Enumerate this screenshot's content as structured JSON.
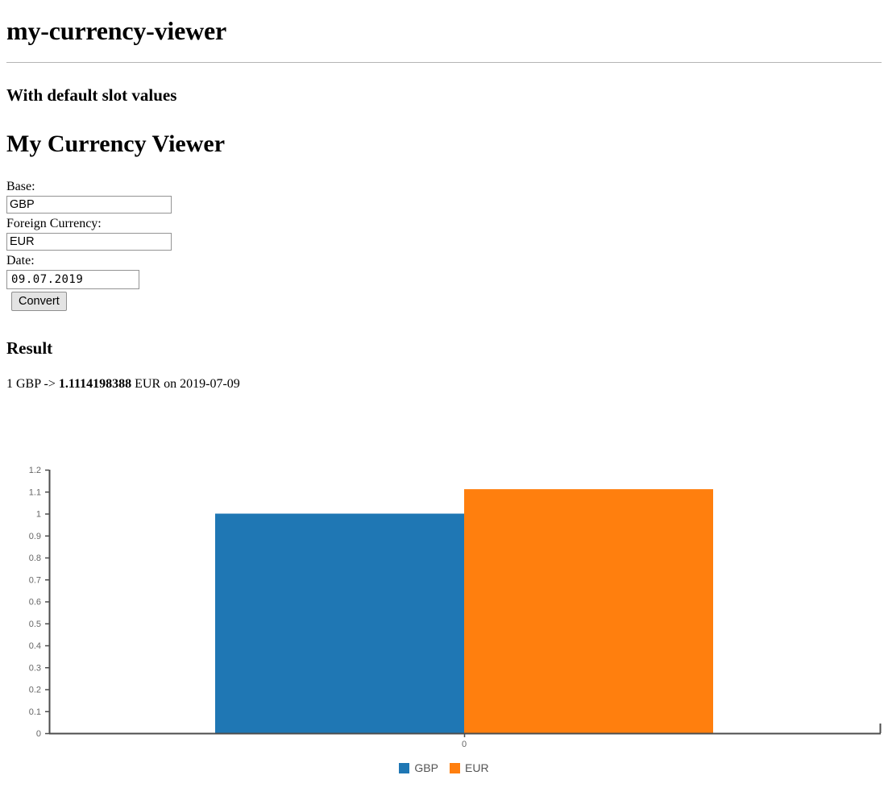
{
  "app": {
    "title": "my-currency-viewer"
  },
  "section": {
    "title": "With default slot values"
  },
  "widget": {
    "title": "My Currency Viewer",
    "form": {
      "base_label": "Base:",
      "base_value": "GBP",
      "base_placeholder": "",
      "foreign_label": "Foreign Currency:",
      "foreign_value": "EUR",
      "foreign_placeholder": "",
      "date_label": "Date:",
      "date_value": "09.07.2019",
      "date_placeholder": "dd.mm.yyyy",
      "convert_label": "Convert"
    },
    "result": {
      "title": "Result",
      "prefix": "1 GBP -> ",
      "rate": "1.1114198388",
      "suffix": " EUR on 2019-07-09"
    }
  },
  "chart_data": {
    "type": "bar",
    "title": "",
    "xlabel": "",
    "ylabel": "",
    "categories": [
      "0"
    ],
    "series": [
      {
        "name": "GBP",
        "values": [
          1
        ],
        "color": "#1f77b4"
      },
      {
        "name": "EUR",
        "values": [
          1.1114198388
        ],
        "color": "#ff7f0e"
      }
    ],
    "ylim": [
      0,
      1.2
    ],
    "ytick_labels": [
      "1.2",
      "1.1",
      "1",
      "0.9",
      "0.8",
      "0.7",
      "0.6",
      "0.5",
      "0.4",
      "0.3",
      "0.2",
      "0.1",
      "0"
    ],
    "xtick_labels": [
      "0"
    ],
    "grid": false,
    "legend_position": "bottom",
    "axis_color": "#4d4d4d"
  }
}
